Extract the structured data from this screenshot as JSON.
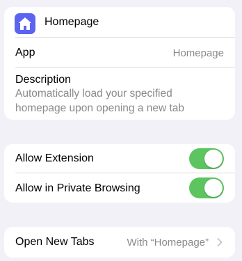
{
  "extension": {
    "icon": "house-icon",
    "name": "Homepage"
  },
  "info": {
    "app_label": "App",
    "app_value": "Homepage",
    "description_label": "Description",
    "description_text": "Automatically load your specified homepage upon opening a new tab"
  },
  "permissions": {
    "allow_extension_label": "Allow Extension",
    "allow_extension_on": true,
    "allow_private_label": "Allow in Private Browsing",
    "allow_private_on": true
  },
  "new_tabs": {
    "label": "Open New Tabs",
    "value": "With “Homepage”"
  },
  "colors": {
    "background": "#f2f1f7",
    "toggle_on": "#5cc560",
    "icon_bg": "#5b63f0",
    "secondary_text": "#8a8a8e"
  }
}
